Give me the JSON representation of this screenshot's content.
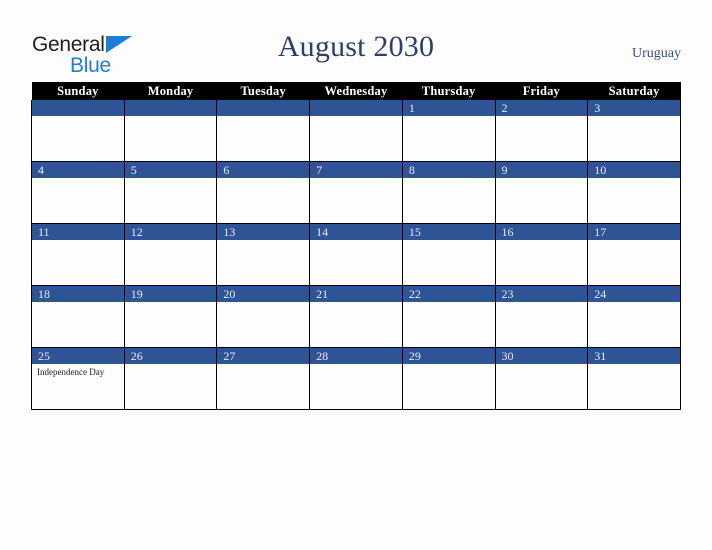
{
  "brand": {
    "name_part1": "General",
    "name_part2": "Blue",
    "triangle_icon": "triangle-icon",
    "colors": {
      "dark": "#231f20",
      "blue": "#1b7fd4"
    }
  },
  "header": {
    "title": "August 2030",
    "country": "Uruguay",
    "title_color": "#2b3f68"
  },
  "calendar": {
    "weekday_headers": [
      "Sunday",
      "Monday",
      "Tuesday",
      "Wednesday",
      "Thursday",
      "Friday",
      "Saturday"
    ],
    "header_bg": "#000000",
    "daynum_bg": "#2f5496",
    "daynum_color": "#e8ecf4",
    "cell_bg": "#fdfdfd",
    "border_color": "#000000",
    "weeks": [
      [
        {
          "day": "",
          "event": ""
        },
        {
          "day": "",
          "event": ""
        },
        {
          "day": "",
          "event": ""
        },
        {
          "day": "",
          "event": ""
        },
        {
          "day": "1",
          "event": ""
        },
        {
          "day": "2",
          "event": ""
        },
        {
          "day": "3",
          "event": ""
        }
      ],
      [
        {
          "day": "4",
          "event": ""
        },
        {
          "day": "5",
          "event": ""
        },
        {
          "day": "6",
          "event": ""
        },
        {
          "day": "7",
          "event": ""
        },
        {
          "day": "8",
          "event": ""
        },
        {
          "day": "9",
          "event": ""
        },
        {
          "day": "10",
          "event": ""
        }
      ],
      [
        {
          "day": "11",
          "event": ""
        },
        {
          "day": "12",
          "event": ""
        },
        {
          "day": "13",
          "event": ""
        },
        {
          "day": "14",
          "event": ""
        },
        {
          "day": "15",
          "event": ""
        },
        {
          "day": "16",
          "event": ""
        },
        {
          "day": "17",
          "event": ""
        }
      ],
      [
        {
          "day": "18",
          "event": ""
        },
        {
          "day": "19",
          "event": ""
        },
        {
          "day": "20",
          "event": ""
        },
        {
          "day": "21",
          "event": ""
        },
        {
          "day": "22",
          "event": ""
        },
        {
          "day": "23",
          "event": ""
        },
        {
          "day": "24",
          "event": ""
        }
      ],
      [
        {
          "day": "25",
          "event": "Independence Day"
        },
        {
          "day": "26",
          "event": ""
        },
        {
          "day": "27",
          "event": ""
        },
        {
          "day": "28",
          "event": ""
        },
        {
          "day": "29",
          "event": ""
        },
        {
          "day": "30",
          "event": ""
        },
        {
          "day": "31",
          "event": ""
        }
      ]
    ]
  }
}
